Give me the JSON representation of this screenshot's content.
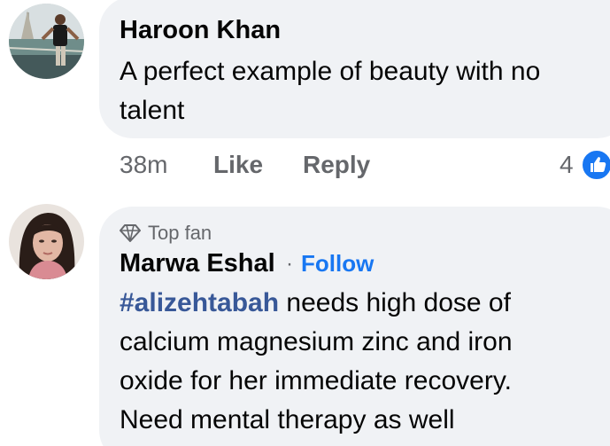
{
  "comments": [
    {
      "author": "Haroon Khan",
      "text_lines": [
        "A perfect example of beauty with no",
        "talent"
      ],
      "time": "38m",
      "like_label": "Like",
      "reply_label": "Reply",
      "reaction_count": "4",
      "reaction_icon": "thumbs-up-icon"
    },
    {
      "badge": "Top fan",
      "badge_icon": "diamond-icon",
      "author": "Marwa Eshal",
      "separator": "·",
      "follow_label": "Follow",
      "hashtag": "#alizehtabah",
      "text_lines": [
        " needs high dose of",
        "calcium magnesium zinc and iron",
        "oxide for her immediate recovery.",
        "Need mental therapy as well"
      ]
    }
  ],
  "colors": {
    "bubble": "#f0f2f5",
    "link": "#1877f2",
    "hashtag": "#385898",
    "meta_text": "#65676b"
  }
}
